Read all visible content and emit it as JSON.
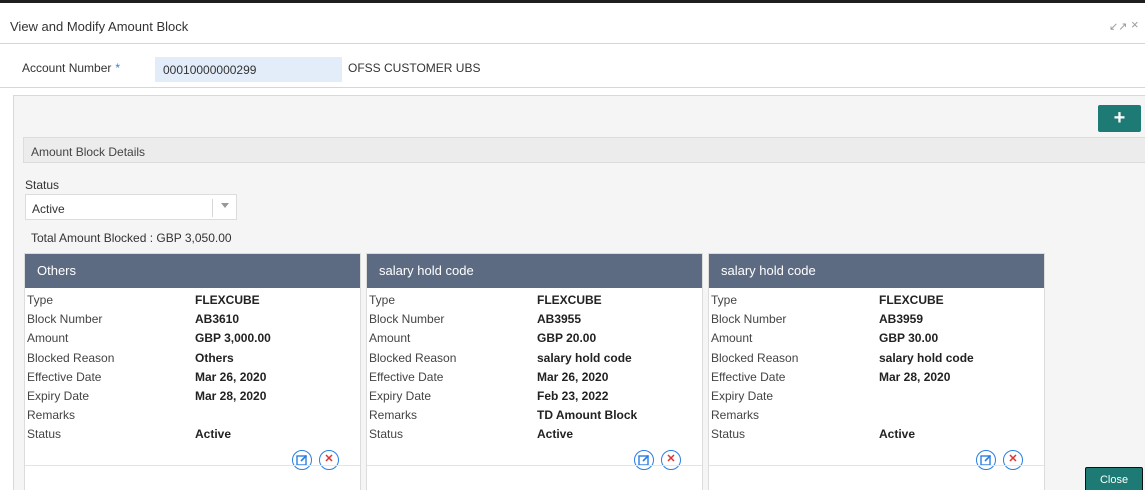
{
  "window": {
    "title": "View and Modify Amount Block"
  },
  "account": {
    "label": "Account Number",
    "required_mark": "*",
    "value": "00010000000299",
    "customer_name": "OFSS CUSTOMER UBS"
  },
  "toolbar": {
    "add_label": "+"
  },
  "section": {
    "title": "Amount Block Details"
  },
  "filter": {
    "status_label": "Status",
    "status_value": "Active"
  },
  "total": {
    "text": "Total Amount Blocked : GBP 3,050.00"
  },
  "cards": [
    {
      "title": "Others",
      "rows": [
        {
          "k": "Type",
          "v": "FLEXCUBE"
        },
        {
          "k": "Block Number",
          "v": "AB3610"
        },
        {
          "k": "Amount",
          "v": "GBP 3,000.00"
        },
        {
          "k": "Blocked Reason",
          "v": "Others"
        },
        {
          "k": "Effective Date",
          "v": "Mar 26, 2020"
        },
        {
          "k": "Expiry Date",
          "v": "Mar 28, 2020"
        },
        {
          "k": "Remarks",
          "v": ""
        },
        {
          "k": "Status",
          "v": "Active"
        }
      ]
    },
    {
      "title": "salary hold code",
      "rows": [
        {
          "k": "Type",
          "v": "FLEXCUBE"
        },
        {
          "k": "Block Number",
          "v": "AB3955"
        },
        {
          "k": "Amount",
          "v": "GBP 20.00"
        },
        {
          "k": "Blocked Reason",
          "v": "salary hold code"
        },
        {
          "k": "Effective Date",
          "v": "Mar 26, 2020"
        },
        {
          "k": "Expiry Date",
          "v": "Feb 23, 2022"
        },
        {
          "k": "Remarks",
          "v": "TD Amount Block"
        },
        {
          "k": "Status",
          "v": "Active"
        }
      ]
    },
    {
      "title": "salary hold code",
      "rows": [
        {
          "k": "Type",
          "v": "FLEXCUBE"
        },
        {
          "k": "Block Number",
          "v": "AB3959"
        },
        {
          "k": "Amount",
          "v": "GBP 30.00"
        },
        {
          "k": "Blocked Reason",
          "v": "salary hold code"
        },
        {
          "k": "Effective Date",
          "v": "Mar 28, 2020"
        },
        {
          "k": "Expiry Date",
          "v": ""
        },
        {
          "k": "Remarks",
          "v": ""
        },
        {
          "k": "Status",
          "v": "Active"
        }
      ]
    }
  ],
  "footer": {
    "close_label": "Close"
  },
  "colors": {
    "accent": "#1d7a74",
    "card_header": "#5d6b82",
    "link": "#2a7ee1",
    "danger": "#dd3333"
  }
}
